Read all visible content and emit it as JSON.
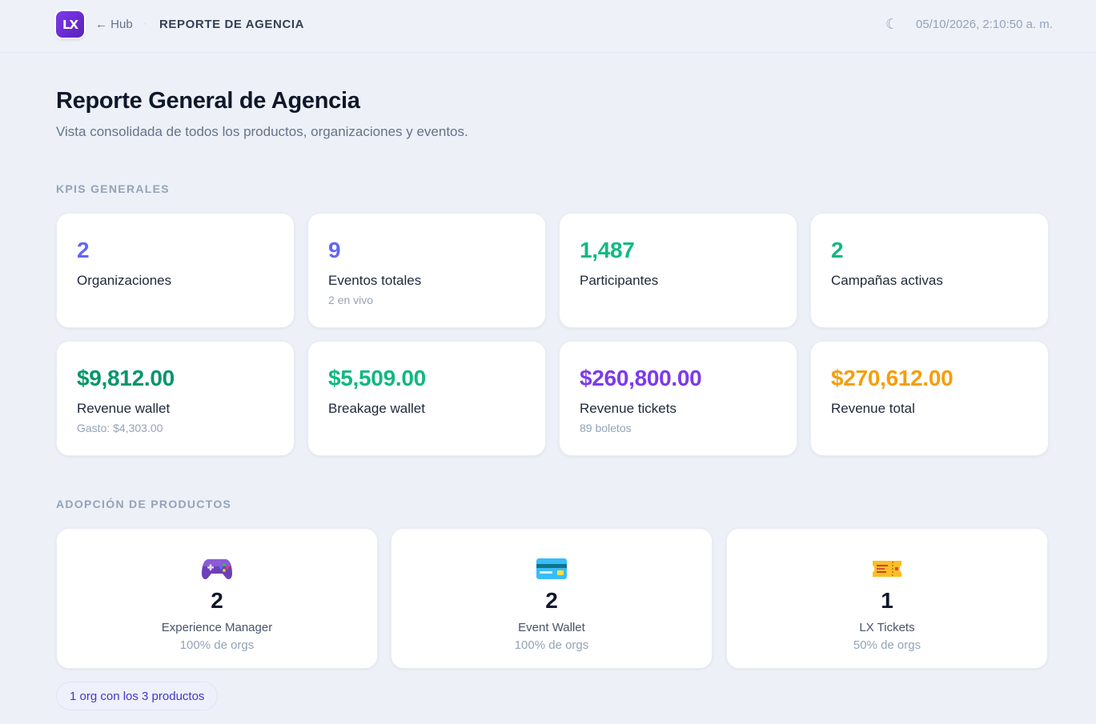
{
  "header": {
    "logo_text": "LX",
    "back_label": "← Hub",
    "separator": "·",
    "crumb": "REPORTE DE AGENCIA",
    "theme_icon": "☾",
    "datetime": "05/10/2026, 2:10:50 a. m."
  },
  "page": {
    "title": "Reporte General de Agencia",
    "subtitle": "Vista consolidada de todos los productos, organizaciones y eventos."
  },
  "kpis": {
    "section_label": "KPIS GENERALES",
    "cards": [
      {
        "value": "2",
        "label": "Organizaciones",
        "sub": "",
        "color": "#6366f1"
      },
      {
        "value": "9",
        "label": "Eventos totales",
        "sub": "2 en vivo",
        "color": "#6366f1"
      },
      {
        "value": "1,487",
        "label": "Participantes",
        "sub": "",
        "color": "#10b981"
      },
      {
        "value": "2",
        "label": "Campañas activas",
        "sub": "",
        "color": "#10b981"
      },
      {
        "value": "$9,812.00",
        "label": "Revenue wallet",
        "sub": "Gasto: $4,303.00",
        "color": "#059669"
      },
      {
        "value": "$5,509.00",
        "label": "Breakage wallet",
        "sub": "",
        "color": "#10b981"
      },
      {
        "value": "$260,800.00",
        "label": "Revenue tickets",
        "sub": "89 boletos",
        "color": "#7c3aed"
      },
      {
        "value": "$270,612.00",
        "label": "Revenue total",
        "sub": "",
        "color": "#f59e0b"
      }
    ]
  },
  "adoption": {
    "section_label": "ADOPCIÓN DE PRODUCTOS",
    "products": [
      {
        "icon": "game-controller-icon",
        "count": "2",
        "name": "Experience Manager",
        "pct": "100% de orgs"
      },
      {
        "icon": "credit-card-icon",
        "count": "2",
        "name": "Event Wallet",
        "pct": "100% de orgs"
      },
      {
        "icon": "ticket-icon",
        "count": "1",
        "name": "LX Tickets",
        "pct": "50% de orgs"
      }
    ],
    "summary_pill": "1 org con los 3 productos"
  }
}
